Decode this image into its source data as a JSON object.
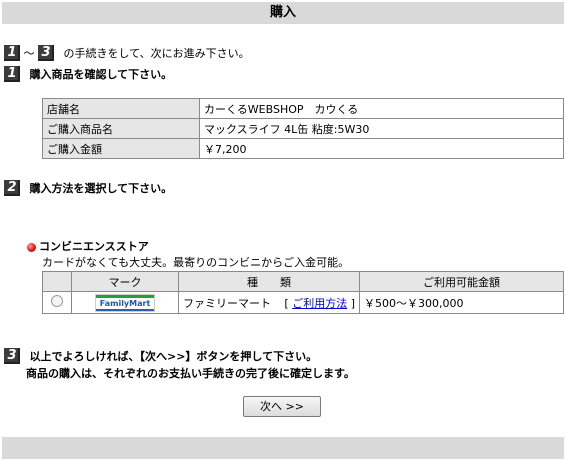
{
  "page": {
    "title": "購入"
  },
  "intro": {
    "step_from": "1",
    "step_to": "3",
    "tilde": "～",
    "text": "の手続きをして、次にお進み下さい。"
  },
  "step1": {
    "number": "1",
    "heading": "購入商品を確認して下さい。",
    "rows": [
      {
        "label": "店舗名",
        "value": "カーくるWEBSHOP　カウくる"
      },
      {
        "label": "ご購入商品名",
        "value": "マックスライフ 4L缶 粘度:5W30"
      },
      {
        "label": "ご購入金額",
        "value": "￥7,200"
      }
    ]
  },
  "step2": {
    "number": "2",
    "heading": "購入方法を選択して下さい。",
    "method_title": "コンビニエンスストア",
    "method_desc": "カードがなくても大丈夫。最寄りのコンビニからご入金可能。",
    "headers": {
      "mark": "マーク",
      "type": "種　　類",
      "range": "ご利用可能金額"
    },
    "options": [
      {
        "logo_text": "FamilyMart",
        "name": "ファミリーマート",
        "bracket_open": "[",
        "link": "ご利用方法",
        "bracket_close": "]",
        "range": "￥500～￥300,000"
      }
    ]
  },
  "step3": {
    "number": "3",
    "line1": "以上でよろしければ、【次へ>>】ボタンを押して下さい。",
    "line2": "商品の購入は、それぞれのお支払い手続きの完了後に確定します。"
  },
  "next_button": {
    "label": "次へ >>"
  },
  "colors": {
    "bar": "#d9d9d9",
    "link": "#0000cc",
    "badge": "#3c3c3c"
  }
}
